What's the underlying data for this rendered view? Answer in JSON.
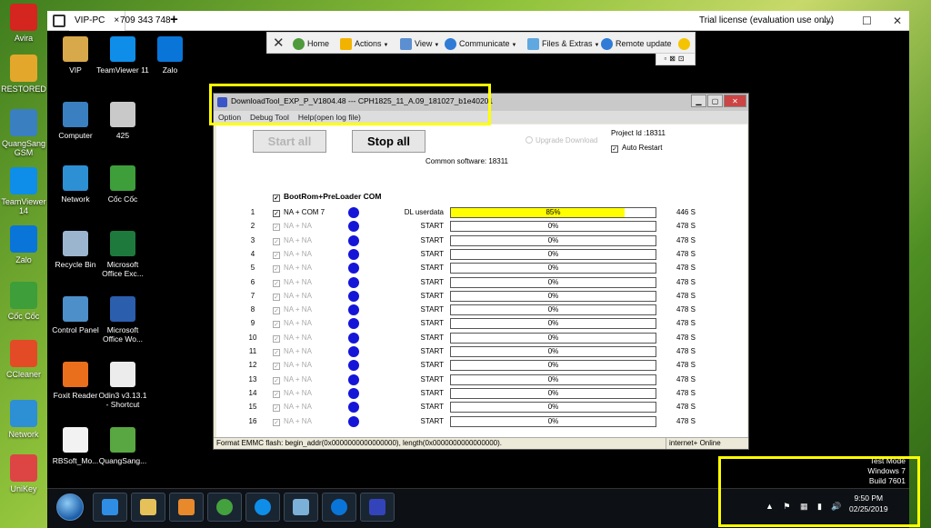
{
  "host_desktop": {
    "icons": [
      "Avira",
      "RESTORED",
      "QuangSang GSM",
      "TeamViewer 14",
      "Zalo",
      "Cốc Cốc",
      "CCleaner",
      "Network",
      "UniKey"
    ]
  },
  "teamviewer": {
    "tabs": [
      {
        "label": "VIP-PC",
        "close": "×"
      },
      {
        "label": "709 343 748"
      }
    ],
    "add_tab": "+",
    "trial_text": "Trial license (evaluation use only)",
    "window_controls": {
      "minimize": "—",
      "maximize": "☐",
      "close": "✕"
    },
    "toolbar": {
      "close": "✕",
      "home": "Home",
      "actions": "Actions",
      "view": "View",
      "communicate": "Communicate",
      "files": "Files & Extras",
      "remote_update": "Remote update"
    },
    "subtool": "▫⊠⊡"
  },
  "remote_desktop": {
    "icons": [
      {
        "label": "VIP",
        "color": "#d8a94a"
      },
      {
        "label": "TeamViewer 11",
        "color": "#0e8ee9"
      },
      {
        "label": "Zalo",
        "color": "#0a75d8"
      },
      {
        "label": "Computer",
        "color": "#3a7fc0"
      },
      {
        "label": "425",
        "color": "#c9c9c9"
      },
      {
        "label": "Network",
        "color": "#2d8fd4"
      },
      {
        "label": "Cốc Cốc",
        "color": "#3d9e3a"
      },
      {
        "label": "Recycle Bin",
        "color": "#9bb5cf"
      },
      {
        "label": "Microsoft Office Exc...",
        "color": "#1e7a3c"
      },
      {
        "label": "Control Panel",
        "color": "#4d8fc9"
      },
      {
        "label": "Microsoft Office Wo...",
        "color": "#2b5ead"
      },
      {
        "label": "Foxit Reader",
        "color": "#e96f1d"
      },
      {
        "label": "Odin3 v3.13.1 - Shortcut",
        "color": "#ececec"
      },
      {
        "label": "RBSoft_Mo...",
        "color": "#f2f2f2"
      },
      {
        "label": "QuangSang...",
        "color": "#58a742"
      }
    ],
    "watermark": {
      "line1": "Test Mode",
      "line2": "Windows 7",
      "line3": "Build 7601"
    },
    "clock": {
      "time": "9:50 PM",
      "date": "02/25/2019"
    },
    "tray_icons": "▲ ⚑ ▦ ▮ 🔊"
  },
  "download_tool": {
    "title": "DownloadTool_EXP_P_V1804.48 --- CPH1825_11_A.09_181027_b1e40201",
    "menu": [
      "Option",
      "Debug Tool",
      "Help(open log file)"
    ],
    "start_all": "Start all",
    "stop_all": "Stop all",
    "upgrade_download": "Upgrade Download",
    "project_id": "Project Id :18311",
    "auto_restart": "Auto Restart",
    "common_software": "Common software: 18311",
    "bootrom_label": "BootRom+PreLoader COM",
    "ports": [
      {
        "num": "1",
        "port": "NA + COM  7",
        "status": "DL userdata",
        "progress": 0.85,
        "pct": "85%",
        "time": "446 S",
        "active": true
      },
      {
        "num": "2",
        "port": "NA + NA",
        "status": "START",
        "progress": 0,
        "pct": "0%",
        "time": "478 S",
        "active": false
      },
      {
        "num": "3",
        "port": "NA + NA",
        "status": "START",
        "progress": 0,
        "pct": "0%",
        "time": "478 S",
        "active": false
      },
      {
        "num": "4",
        "port": "NA + NA",
        "status": "START",
        "progress": 0,
        "pct": "0%",
        "time": "478 S",
        "active": false
      },
      {
        "num": "5",
        "port": "NA + NA",
        "status": "START",
        "progress": 0,
        "pct": "0%",
        "time": "478 S",
        "active": false
      },
      {
        "num": "6",
        "port": "NA + NA",
        "status": "START",
        "progress": 0,
        "pct": "0%",
        "time": "478 S",
        "active": false
      },
      {
        "num": "7",
        "port": "NA + NA",
        "status": "START",
        "progress": 0,
        "pct": "0%",
        "time": "478 S",
        "active": false
      },
      {
        "num": "8",
        "port": "NA + NA",
        "status": "START",
        "progress": 0,
        "pct": "0%",
        "time": "478 S",
        "active": false
      },
      {
        "num": "9",
        "port": "NA + NA",
        "status": "START",
        "progress": 0,
        "pct": "0%",
        "time": "478 S",
        "active": false
      },
      {
        "num": "10",
        "port": "NA + NA",
        "status": "START",
        "progress": 0,
        "pct": "0%",
        "time": "478 S",
        "active": false
      },
      {
        "num": "11",
        "port": "NA + NA",
        "status": "START",
        "progress": 0,
        "pct": "0%",
        "time": "478 S",
        "active": false
      },
      {
        "num": "12",
        "port": "NA + NA",
        "status": "START",
        "progress": 0,
        "pct": "0%",
        "time": "478 S",
        "active": false
      },
      {
        "num": "13",
        "port": "NA + NA",
        "status": "START",
        "progress": 0,
        "pct": "0%",
        "time": "478 S",
        "active": false
      },
      {
        "num": "14",
        "port": "NA + NA",
        "status": "START",
        "progress": 0,
        "pct": "0%",
        "time": "478 S",
        "active": false
      },
      {
        "num": "15",
        "port": "NA + NA",
        "status": "START",
        "progress": 0,
        "pct": "0%",
        "time": "478 S",
        "active": false
      },
      {
        "num": "16",
        "port": "NA + NA",
        "status": "START",
        "progress": 0,
        "pct": "0%",
        "time": "478 S",
        "active": false
      }
    ],
    "status_left": "Format EMMC flash:  begin_addr(0x0000000000000000), length(0x0000000000000000).",
    "status_right": "internet+ Online"
  },
  "colors": {
    "highlight": "#ffff00",
    "progress_fill": "#ffff00",
    "port_dot": "#1515d8"
  }
}
